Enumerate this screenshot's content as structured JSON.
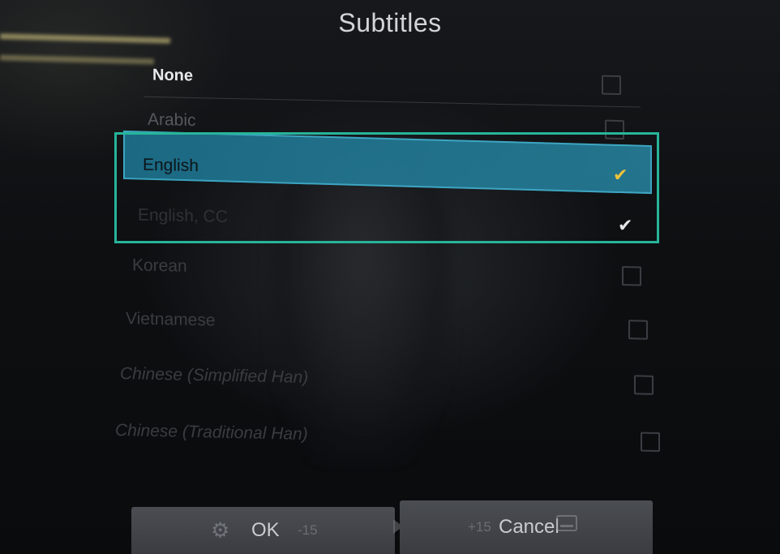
{
  "dialog": {
    "title": "Subtitles"
  },
  "options": [
    {
      "label": "None",
      "checked": false,
      "focused": false
    },
    {
      "label": "Arabic",
      "checked": false,
      "focused": false
    },
    {
      "label": "English",
      "checked": true,
      "focused": true
    },
    {
      "label": "English, CC",
      "checked": true,
      "focused": false
    },
    {
      "label": "Korean",
      "checked": false,
      "focused": false
    },
    {
      "label": "Vietnamese",
      "checked": false,
      "focused": false
    },
    {
      "label": "Chinese (Simplified Han)",
      "checked": false,
      "focused": false
    },
    {
      "label": "Chinese (Traditional Han)",
      "checked": false,
      "focused": false
    }
  ],
  "icons": {
    "check_glyph": "✔",
    "gear_glyph": "⚙"
  },
  "footer": {
    "ok_label": "OK",
    "cancel_label": "Cancel",
    "rewind_label": "-15",
    "forward_label": "+15"
  },
  "colors": {
    "highlight": "#1e7896",
    "focus_frame": "#27b49a",
    "check_focused": "#f0c23a",
    "check_default": "#e6e6e6"
  }
}
